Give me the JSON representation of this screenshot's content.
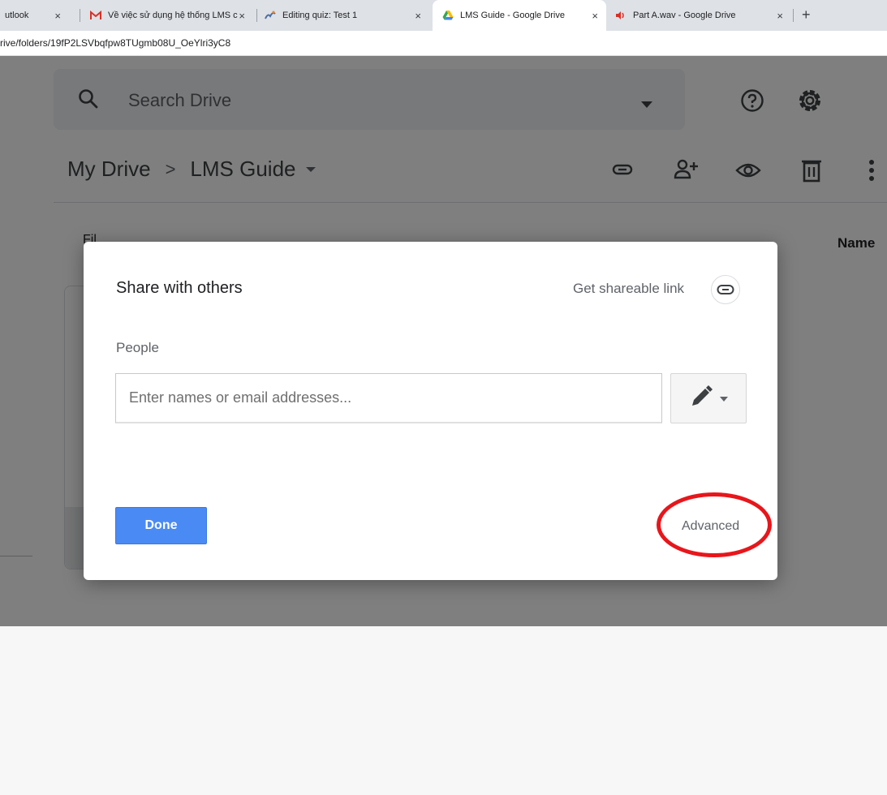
{
  "browser": {
    "tabs": [
      {
        "title": "utlook",
        "favicon": "outlook-icon",
        "active": false
      },
      {
        "title": "Về việc sử dụng hệ thống LMS c",
        "favicon": "gmail-icon",
        "active": false
      },
      {
        "title": "Editing quiz: Test 1",
        "favicon": "moodle-icon",
        "active": false
      },
      {
        "title": "LMS Guide - Google Drive",
        "favicon": "google-drive-icon",
        "active": true
      },
      {
        "title": "Part A.wav - Google Drive",
        "favicon": "audio-playing-icon",
        "active": false
      }
    ],
    "close_glyph": "×",
    "new_tab_glyph": "+",
    "url": "rive/folders/19fP2LSVbqfpw8TUgmb08U_OeYlri3yC8"
  },
  "drive": {
    "search_placeholder": "Search Drive",
    "breadcrumb": {
      "root": "My Drive",
      "separator": ">",
      "current": "LMS Guide"
    },
    "toolbar_icons": [
      "link-icon",
      "add-person-icon",
      "eye-icon",
      "trash-icon",
      "more-vert-icon"
    ],
    "files_heading": "Fil",
    "name_column": "Name"
  },
  "dialog": {
    "title": "Share with others",
    "shareable_link_label": "Get shareable link",
    "people_label": "People",
    "people_placeholder": "Enter names or email addresses...",
    "permission_icon": "pencil-icon",
    "done_label": "Done",
    "advanced_label": "Advanced"
  },
  "colors": {
    "done_button": "#4a8af4",
    "annotation_circle": "#e8161b",
    "overlay": "rgba(0,0,0,0.5)"
  }
}
